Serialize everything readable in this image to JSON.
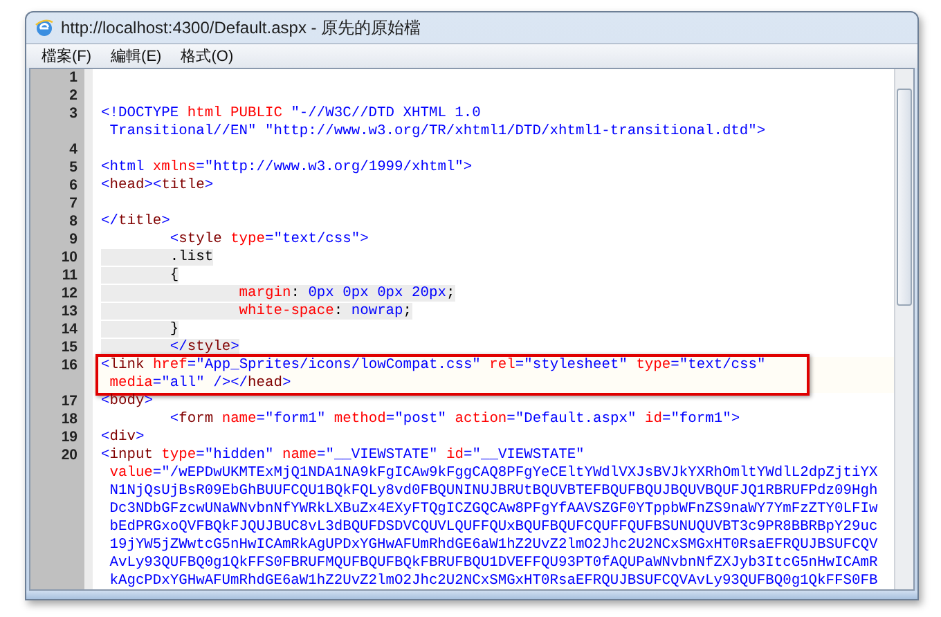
{
  "window": {
    "title": "http://localhost:4300/Default.aspx - 原先的原始檔"
  },
  "menu": [
    "檔案(F)",
    "編輯(E)",
    "格式(O)"
  ],
  "lines": [
    {
      "number": "1",
      "shaded": false,
      "highlighted": false
    },
    {
      "number": "2",
      "shaded": false,
      "highlighted": false
    },
    {
      "number": "3",
      "shaded": false,
      "highlighted": false,
      "rows": [
        {
          "spans": [
            {
              "kind": "bracket",
              "text": "<!DOCTYPE "
            },
            {
              "kind": "attr",
              "text": "html PUBLIC "
            },
            {
              "kind": "value",
              "text": "\"-//W3C//DTD XHTML 1.0"
            }
          ]
        },
        {
          "spans": [
            {
              "kind": "value",
              "text": " Transitional//EN\" \"http://www.w3.org/TR/xhtml1/DTD/xhtml1-transitional.dtd\""
            },
            {
              "kind": "bracket",
              "text": ">"
            }
          ]
        }
      ]
    },
    {
      "number": "4",
      "shaded": false,
      "highlighted": false
    },
    {
      "number": "5",
      "shaded": false,
      "highlighted": false,
      "rows": [
        {
          "spans": [
            {
              "kind": "bracket",
              "text": "<html "
            },
            {
              "kind": "attr",
              "text": "xmlns"
            },
            {
              "kind": "bracket",
              "text": "="
            },
            {
              "kind": "value",
              "text": "\"http://www.w3.org/1999/xhtml\""
            },
            {
              "kind": "bracket",
              "text": ">"
            }
          ]
        }
      ]
    },
    {
      "number": "6",
      "shaded": false,
      "highlighted": false,
      "rows": [
        {
          "spans": [
            {
              "kind": "bracket",
              "text": "<"
            },
            {
              "kind": "tag",
              "text": "head"
            },
            {
              "kind": "bracket",
              "text": "><"
            },
            {
              "kind": "tag",
              "text": "title"
            },
            {
              "kind": "bracket",
              "text": ">"
            }
          ]
        }
      ]
    },
    {
      "number": "7",
      "shaded": false,
      "highlighted": false
    },
    {
      "number": "8",
      "shaded": false,
      "highlighted": false,
      "rows": [
        {
          "spans": [
            {
              "kind": "bracket",
              "text": "</"
            },
            {
              "kind": "tag",
              "text": "title"
            },
            {
              "kind": "bracket",
              "text": ">"
            }
          ]
        }
      ]
    },
    {
      "number": "9",
      "shaded": false,
      "highlighted": false,
      "rows": [
        {
          "spans": [
            {
              "kind": "bracket",
              "text": "\t<"
            },
            {
              "kind": "tag",
              "text": "style "
            },
            {
              "kind": "attr",
              "text": "type"
            },
            {
              "kind": "bracket",
              "text": "="
            },
            {
              "kind": "value",
              "text": "\"text/css\""
            },
            {
              "kind": "bracket",
              "text": ">"
            }
          ]
        }
      ]
    },
    {
      "number": "10",
      "shaded": true,
      "highlighted": false,
      "rows": [
        {
          "spans": [
            {
              "kind": "plain",
              "text": "\t.list"
            }
          ]
        }
      ]
    },
    {
      "number": "11",
      "shaded": true,
      "highlighted": false,
      "rows": [
        {
          "spans": [
            {
              "kind": "plain",
              "text": "\t{"
            }
          ]
        }
      ]
    },
    {
      "number": "12",
      "shaded": true,
      "highlighted": false,
      "rows": [
        {
          "spans": [
            {
              "kind": "attr",
              "text": "\t\tmargin"
            },
            {
              "kind": "plain",
              "text": ": "
            },
            {
              "kind": "value",
              "text": "0px 0px 0px 20px"
            },
            {
              "kind": "plain",
              "text": ";"
            }
          ]
        }
      ]
    },
    {
      "number": "13",
      "shaded": true,
      "highlighted": false,
      "rows": [
        {
          "spans": [
            {
              "kind": "attr",
              "text": "\t\twhite-space"
            },
            {
              "kind": "plain",
              "text": ": "
            },
            {
              "kind": "value",
              "text": "nowrap"
            },
            {
              "kind": "plain",
              "text": ";"
            }
          ]
        }
      ]
    },
    {
      "number": "14",
      "shaded": true,
      "highlighted": false,
      "rows": [
        {
          "spans": [
            {
              "kind": "plain",
              "text": "\t}"
            }
          ]
        }
      ]
    },
    {
      "number": "15",
      "shaded": true,
      "highlighted": false,
      "rows": [
        {
          "spans": [
            {
              "kind": "bracket",
              "text": "\t</"
            },
            {
              "kind": "tag",
              "text": "style"
            },
            {
              "kind": "bracket",
              "text": ">"
            }
          ]
        }
      ]
    },
    {
      "number": "16",
      "shaded": false,
      "highlighted": true,
      "rows": [
        {
          "spans": [
            {
              "kind": "bracket",
              "text": "<"
            },
            {
              "kind": "tag",
              "text": "link "
            },
            {
              "kind": "attr",
              "text": "href"
            },
            {
              "kind": "bracket",
              "text": "="
            },
            {
              "kind": "value",
              "text": "\"App_Sprites/icons/lowCompat.css\" "
            },
            {
              "kind": "attr",
              "text": "rel"
            },
            {
              "kind": "bracket",
              "text": "="
            },
            {
              "kind": "value",
              "text": "\"stylesheet\" "
            },
            {
              "kind": "attr",
              "text": "type"
            },
            {
              "kind": "bracket",
              "text": "="
            },
            {
              "kind": "value",
              "text": "\"text/css\""
            }
          ]
        },
        {
          "spans": [
            {
              "kind": "attr",
              "text": " media"
            },
            {
              "kind": "bracket",
              "text": "="
            },
            {
              "kind": "value",
              "text": "\"all\" "
            },
            {
              "kind": "bracket",
              "text": "/></"
            },
            {
              "kind": "tag",
              "text": "head"
            },
            {
              "kind": "bracket",
              "text": ">"
            }
          ]
        }
      ]
    },
    {
      "number": "17",
      "shaded": false,
      "highlighted": false,
      "rows": [
        {
          "spans": [
            {
              "kind": "bracket",
              "text": "<"
            },
            {
              "kind": "tag",
              "text": "body"
            },
            {
              "kind": "bracket",
              "text": ">"
            }
          ]
        }
      ]
    },
    {
      "number": "18",
      "shaded": false,
      "highlighted": false,
      "rows": [
        {
          "spans": [
            {
              "kind": "bracket",
              "text": "\t<"
            },
            {
              "kind": "tag",
              "text": "form "
            },
            {
              "kind": "attr",
              "text": "name"
            },
            {
              "kind": "bracket",
              "text": "="
            },
            {
              "kind": "value",
              "text": "\"form1\" "
            },
            {
              "kind": "attr",
              "text": "method"
            },
            {
              "kind": "bracket",
              "text": "="
            },
            {
              "kind": "value",
              "text": "\"post\" "
            },
            {
              "kind": "attr",
              "text": "action"
            },
            {
              "kind": "bracket",
              "text": "="
            },
            {
              "kind": "value",
              "text": "\"Default.aspx\" "
            },
            {
              "kind": "attr",
              "text": "id"
            },
            {
              "kind": "bracket",
              "text": "="
            },
            {
              "kind": "value",
              "text": "\"form1\""
            },
            {
              "kind": "bracket",
              "text": ">"
            }
          ]
        }
      ]
    },
    {
      "number": "19",
      "shaded": false,
      "highlighted": false,
      "rows": [
        {
          "spans": [
            {
              "kind": "bracket",
              "text": "<"
            },
            {
              "kind": "tag",
              "text": "div"
            },
            {
              "kind": "bracket",
              "text": ">"
            }
          ]
        }
      ]
    },
    {
      "number": "20",
      "shaded": false,
      "highlighted": false,
      "rows": [
        {
          "spans": [
            {
              "kind": "bracket",
              "text": "<"
            },
            {
              "kind": "tag",
              "text": "input "
            },
            {
              "kind": "attr",
              "text": "type"
            },
            {
              "kind": "bracket",
              "text": "="
            },
            {
              "kind": "value",
              "text": "\"hidden\" "
            },
            {
              "kind": "attr",
              "text": "name"
            },
            {
              "kind": "bracket",
              "text": "="
            },
            {
              "kind": "value",
              "text": "\"__VIEWSTATE\" "
            },
            {
              "kind": "attr",
              "text": "id"
            },
            {
              "kind": "bracket",
              "text": "="
            },
            {
              "kind": "value",
              "text": "\"__VIEWSTATE\""
            }
          ]
        },
        {
          "spans": [
            {
              "kind": "attr",
              "text": " value"
            },
            {
              "kind": "bracket",
              "text": "="
            },
            {
              "kind": "value",
              "text": "\"/wEPDwUKMTExMjQ1NDA1NA9kFgICAw9kFggCAQ8PFgYeCEltYWdlVXJsBVJkYXRhOmltYWdlL2dpZjtiYX"
            }
          ]
        },
        {
          "spans": [
            {
              "kind": "value",
              "text": " N1NjQsUjBsR09EbGhBUUFCQU1BQkFQLy8vd0FBQUNINUJBRUtBQUVBTEFBQUFBQUJBQUVBQUFJQ1RBRUFPdz09Hgh"
            }
          ]
        },
        {
          "spans": [
            {
              "kind": "value",
              "text": " Dc3NDbGFzcwUNaWNvbnNfYWRkLXBuZx4EXyFTQgICZGQCAw8PFgYfAAVSZGF0YTppbWFnZS9naWY7YmFzZTY0LFIw"
            }
          ]
        },
        {
          "spans": [
            {
              "kind": "value",
              "text": " bEdPRGxoQVFBQkFJQUJBUC8vL3dBQUFDSDVCQUVLQUFFQUxBQUFBQUFCQUFFQUFBSUNUQUVBT3c9PR8BBRBpY29uc"
            }
          ]
        },
        {
          "spans": [
            {
              "kind": "value",
              "text": " 19jYW5jZWwtcG5nHwICAmRkAgUPDxYGHwAFUmRhdGE6aW1hZ2UvZ2lmO2Jhc2U2NCxSMGxHT0RsaEFRQUJBSUFCQV"
            }
          ]
        },
        {
          "spans": [
            {
              "kind": "value",
              "text": " AvLy93QUFBQ0g1QkFFS0FBRUFMQUFBQUFBQkFBRUFBQU1DVEFFQU93PT0fAQUPaWNvbnNfZXJyb3ItcG5nHwICAmR"
            }
          ]
        },
        {
          "spans": [
            {
              "kind": "value",
              "text": " kAgcPDxYGHwAFUmRhdGE6aW1hZ2UvZ2lmO2Jhc2U2NCxSMGxHT0RsaEFRQUJBSUFCQVAvLy93QUFBQ0g1QkFFS0FB"
            }
          ]
        }
      ]
    }
  ]
}
